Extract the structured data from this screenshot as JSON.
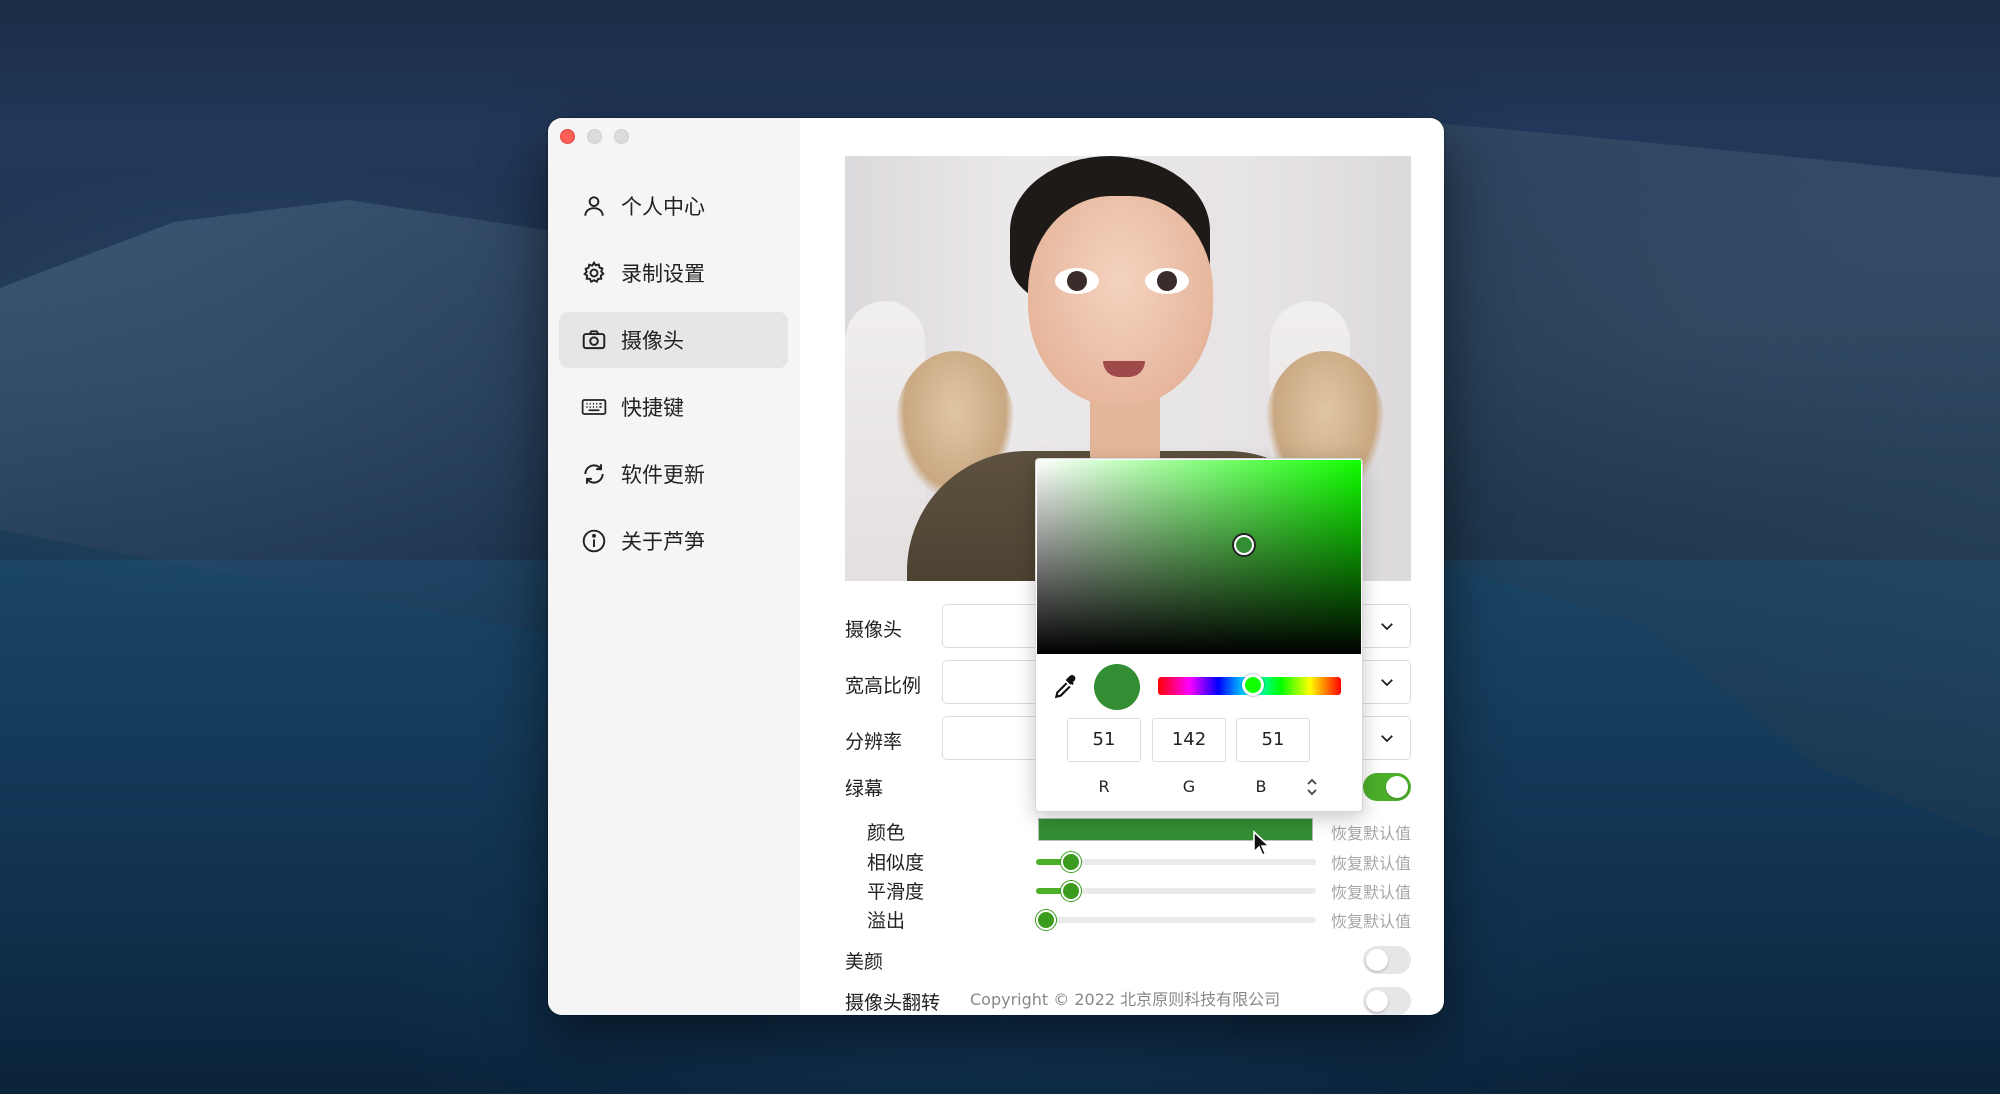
{
  "sidebar": {
    "items": [
      {
        "label": "个人中心",
        "icon": "user-icon"
      },
      {
        "label": "录制设置",
        "icon": "gear-icon"
      },
      {
        "label": "摄像头",
        "icon": "camera-icon"
      },
      {
        "label": "快捷键",
        "icon": "keyboard-icon"
      },
      {
        "label": "软件更新",
        "icon": "refresh-icon"
      },
      {
        "label": "关于芦笋",
        "icon": "info-icon"
      }
    ],
    "active_index": 2
  },
  "settings": {
    "camera_label": "摄像头",
    "aspect_label": "宽高比例",
    "resolution_label": "分辨率",
    "greenscreen_label": "绿幕",
    "greenscreen_on": true,
    "color_label": "颜色",
    "color_value": "#338e33",
    "similarity_label": "相似度",
    "similarity_value": 0.09,
    "smoothness_label": "平滑度",
    "smoothness_value": 0.09,
    "spill_label": "溢出",
    "spill_value": 0.0,
    "reset_label": "恢复默认值",
    "beauty_label": "美颜",
    "beauty_on": false,
    "flip_label": "摄像头翻转",
    "flip_on": false
  },
  "color_picker": {
    "r": "51",
    "g": "142",
    "b": "51",
    "r_label": "R",
    "g_label": "G",
    "b_label": "B",
    "hue_color": "#11ff00",
    "hue_position": 0.52,
    "saturation": 0.64,
    "value": 0.56
  },
  "footer": {
    "copyright": "Copyright © 2022 北京原则科技有限公司"
  },
  "accent_color": "#4caf2a"
}
